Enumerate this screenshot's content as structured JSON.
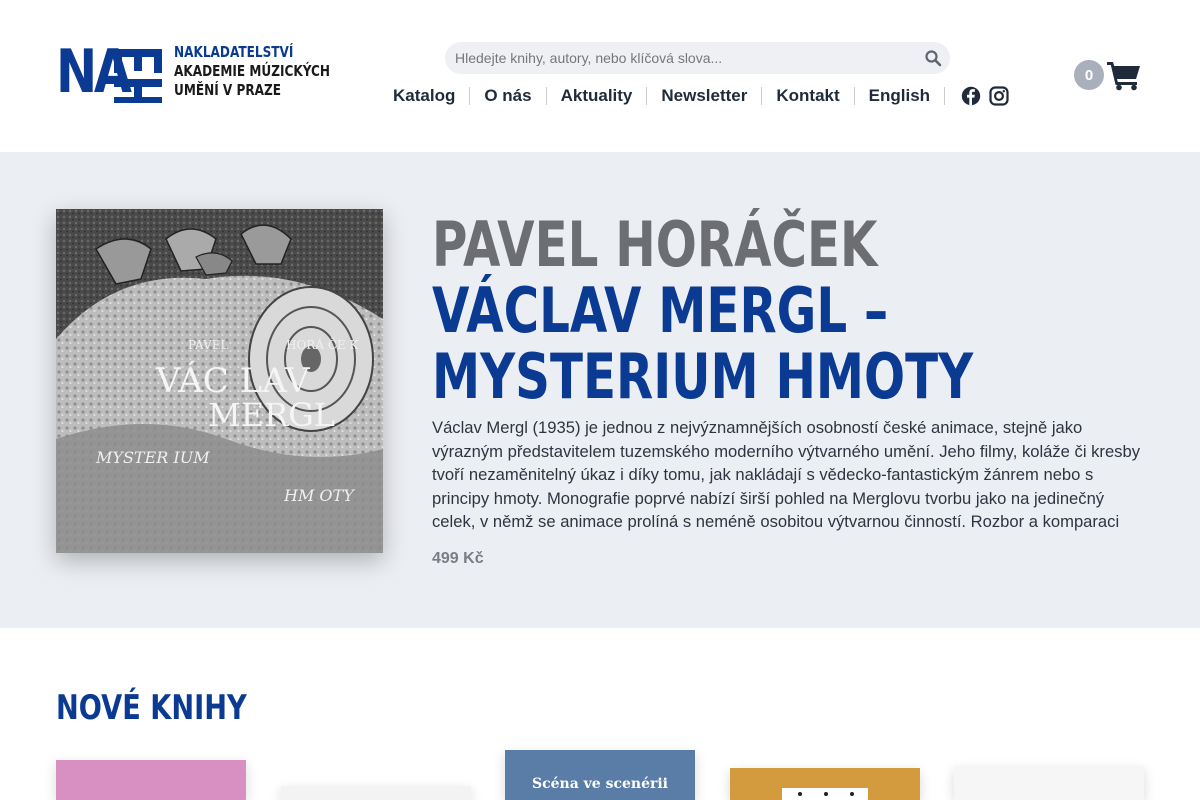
{
  "header": {
    "logo": {
      "mark": "NA",
      "vertical_mark": "MU",
      "lines": [
        "NAKLADATELSTVÍ",
        "AKADEMIE MÚZICKÝCH",
        "UMĚNÍ V PRAZE"
      ]
    },
    "search": {
      "placeholder": "Hledejte knihy, autory, nebo klíčová slova...",
      "value": ""
    },
    "nav": [
      {
        "label": "Katalog"
      },
      {
        "label": "O nás"
      },
      {
        "label": "Aktuality"
      },
      {
        "label": "Newsletter"
      },
      {
        "label": "Kontakt"
      },
      {
        "label": "English"
      }
    ],
    "social_icons": [
      "facebook-icon",
      "instagram-icon"
    ],
    "cart": {
      "count": "0",
      "icon": "cart-icon"
    }
  },
  "hero": {
    "author": "PAVEL HORÁČEK",
    "title": "VÁCLAV MERGL – MYSTERIUM HMOTY",
    "description": "Václav Mergl (1935) je jednou z nejvýznamnějších osobností české animace, stejně jako výrazným představitelem tuzemského moderního výtvarného umění. Jeho filmy, koláže či kresby tvoří nezaměnitelný úkaz i díky tomu, jak nakládají s vědecko-fantastickým žánrem nebo s principy hmoty. Monografie poprvé nabízí širší pohled na Merglovu tvorbu jako na jedinečný celek, v němž se animace prolíná s neméně osobitou výtvarnou činností. Rozbor a komparaci d...",
    "price": "499 Kč",
    "cover": {
      "author_first": "PAVEL",
      "author_last": "HORÁ ČE K",
      "title_line1": "VÁC LAV",
      "title_line2": "MERGL",
      "subtitle_line1": "MYSTER IUM",
      "subtitle_line2": "HM OTY"
    }
  },
  "new_books": {
    "title": "NOVÉ KNIHY",
    "books": [
      {
        "cover_text": ""
      },
      {
        "cover_text": ""
      },
      {
        "cover_text": "Scéna ve scenérii"
      },
      {
        "cover_text": ""
      },
      {
        "cover_text": ""
      }
    ]
  },
  "colors": {
    "brand_blue": "#0b3a92",
    "author_gray": "#6d6e72",
    "hero_background": "#ebeef3",
    "cart_badge": "#a9b0bb"
  }
}
